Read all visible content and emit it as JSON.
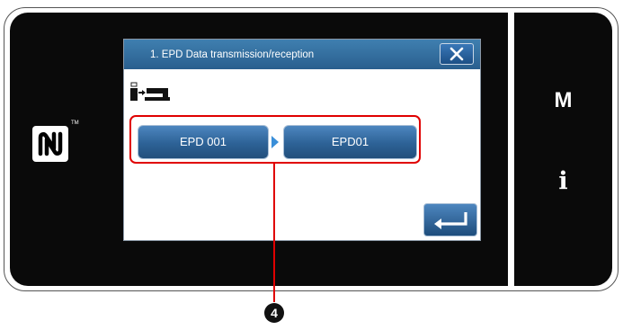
{
  "side_panel": {
    "menu_label": "M",
    "info_label": "i"
  },
  "dialog": {
    "title": "1. EPD Data transmission/reception",
    "source_label": "EPD 001",
    "destination_label": "EPD01"
  },
  "callout": {
    "number": "4"
  },
  "icons": {
    "nfc": "nfc-n-mark-icon",
    "close": "close-x-icon",
    "mode": "panel-to-machine-transfer-icon",
    "enter": "enter-return-arrow-icon"
  },
  "colors": {
    "title_bar": "#2f6a9e",
    "button_blue": "#2d6296",
    "arrow_blue": "#3a8fd9",
    "callout_red": "#e00000",
    "panel_black": "#0a0a0a"
  }
}
